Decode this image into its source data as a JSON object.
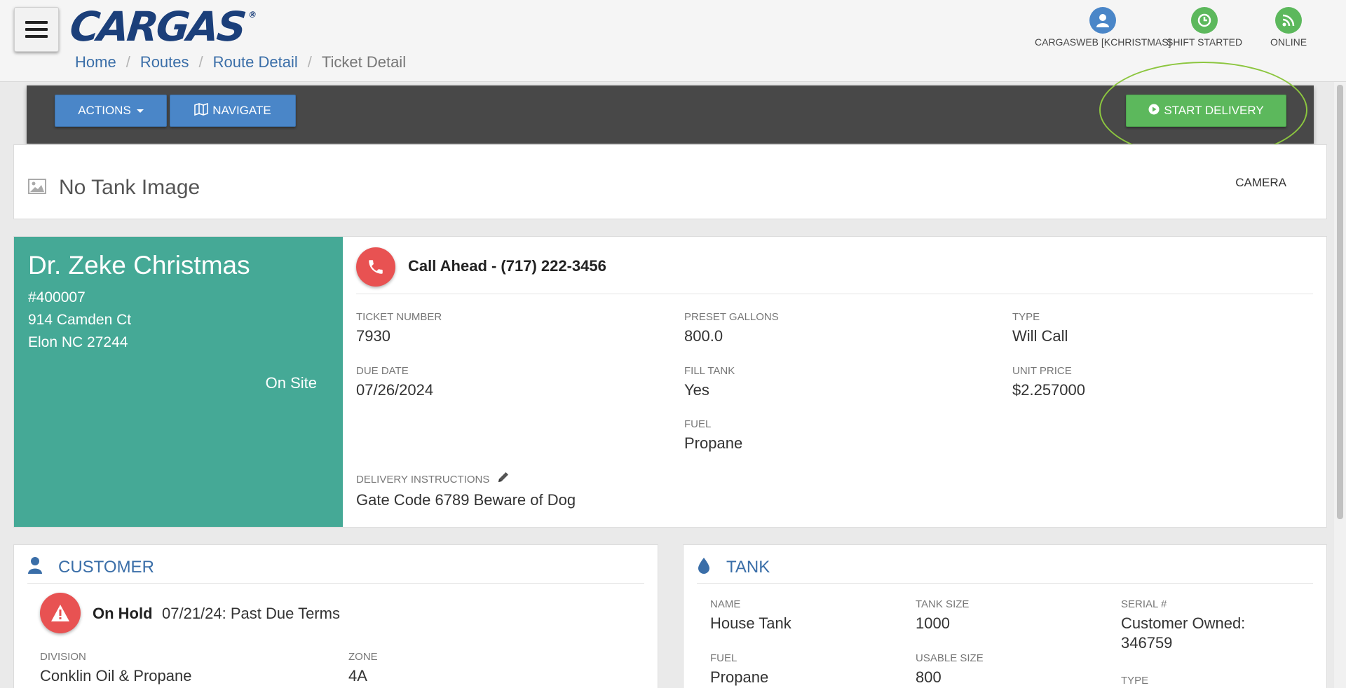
{
  "header": {
    "logo_text": "CARGAS",
    "logo_mark": "®",
    "breadcrumb": {
      "home": "Home",
      "routes": "Routes",
      "route_detail": "Route Detail",
      "current": "Ticket Detail",
      "separator": "/"
    },
    "status": {
      "user": {
        "label": "CARGASWEB [KCHRISTMAS]",
        "icon": "user-icon",
        "color": "#4a86c8"
      },
      "shift": {
        "label": "SHIFT STARTED",
        "icon": "clock-icon",
        "color": "#5cb85c"
      },
      "connection": {
        "label": "ONLINE",
        "icon": "rss-icon",
        "color": "#5cb85c"
      }
    }
  },
  "toolbar": {
    "actions_label": "ACTIONS",
    "navigate_label": "NAVIGATE",
    "start_delivery_label": "START DELIVERY"
  },
  "tank_image": {
    "no_image_text": "No Tank Image",
    "camera_label": "CAMERA"
  },
  "ticket": {
    "customer_name": "Dr. Zeke Christmas",
    "account_number": "#400007",
    "address_line1": "914 Camden Ct",
    "address_line2": "Elon NC 27244",
    "status": "On Site",
    "call_ahead": "Call Ahead - (717) 222-3456",
    "fields": {
      "ticket_number": {
        "label": "TICKET NUMBER",
        "value": "7930"
      },
      "preset_gallons": {
        "label": "PRESET GALLONS",
        "value": "800.0"
      },
      "type": {
        "label": "TYPE",
        "value": "Will Call"
      },
      "due_date": {
        "label": "DUE DATE",
        "value": "07/26/2024"
      },
      "fill_tank": {
        "label": "FILL TANK",
        "value": "Yes"
      },
      "unit_price": {
        "label": "UNIT PRICE",
        "value": "$2.257000"
      },
      "fuel": {
        "label": "FUEL",
        "value": "Propane"
      },
      "delivery_instructions": {
        "label": "DELIVERY INSTRUCTIONS",
        "value": "Gate Code 6789 Beware of Dog"
      }
    }
  },
  "customer_section": {
    "title": "CUSTOMER",
    "hold_label": "On Hold",
    "hold_reason": "07/21/24: Past Due Terms",
    "division": {
      "label": "DIVISION",
      "value": "Conklin Oil & Propane"
    },
    "zone": {
      "label": "ZONE",
      "value": "4A"
    }
  },
  "tank_section": {
    "title": "TANK",
    "name": {
      "label": "NAME",
      "value": "House Tank"
    },
    "tank_size": {
      "label": "TANK SIZE",
      "value": "1000"
    },
    "serial": {
      "label": "SERIAL #",
      "value_line1": "Customer Owned:",
      "value_line2": "346759"
    },
    "fuel": {
      "label": "FUEL",
      "value": "Propane"
    },
    "usable_size": {
      "label": "USABLE SIZE",
      "value": "800"
    },
    "type": {
      "label": "TYPE"
    }
  },
  "colors": {
    "accent_blue": "#4a86c8",
    "accent_green": "#5cb85c",
    "customer_panel": "#45a996",
    "alert_red": "#e85252"
  }
}
